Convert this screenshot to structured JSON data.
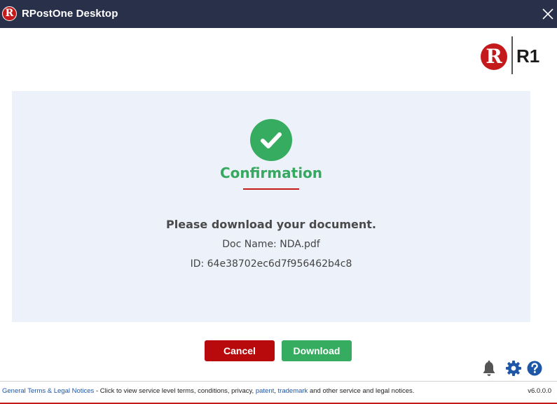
{
  "window": {
    "title": "RPostOne Desktop",
    "app_icon_letter": "R"
  },
  "logo": {
    "letter": "R",
    "text": "R1"
  },
  "confirmation": {
    "icon": "check-icon",
    "title": "Confirmation",
    "message": "Please download your document.",
    "doc_name": "Doc Name: NDA.pdf",
    "doc_id": "ID: 64e38702ec6d7f956462b4c8"
  },
  "buttons": {
    "cancel": "Cancel",
    "download": "Download"
  },
  "footer_icons": [
    "bell-icon",
    "gear-icon",
    "help-icon"
  ],
  "footer": {
    "terms_link": "General Terms & Legal Notices",
    "text1": " - Click to view service level terms, conditions, privacy, ",
    "patent_link": "patent",
    "comma": ", ",
    "trademark_link": "trademark",
    "text2": " and other service and legal notices.",
    "version": "v6.0.0.0"
  },
  "colors": {
    "titlebar": "#28304a",
    "brand_red": "#c51a1b",
    "success_green": "#35ac60",
    "cancel_red": "#b8090c",
    "panel_bg": "#edf1fa",
    "icon_gray": "#555555",
    "icon_blue": "#1e56a8"
  }
}
